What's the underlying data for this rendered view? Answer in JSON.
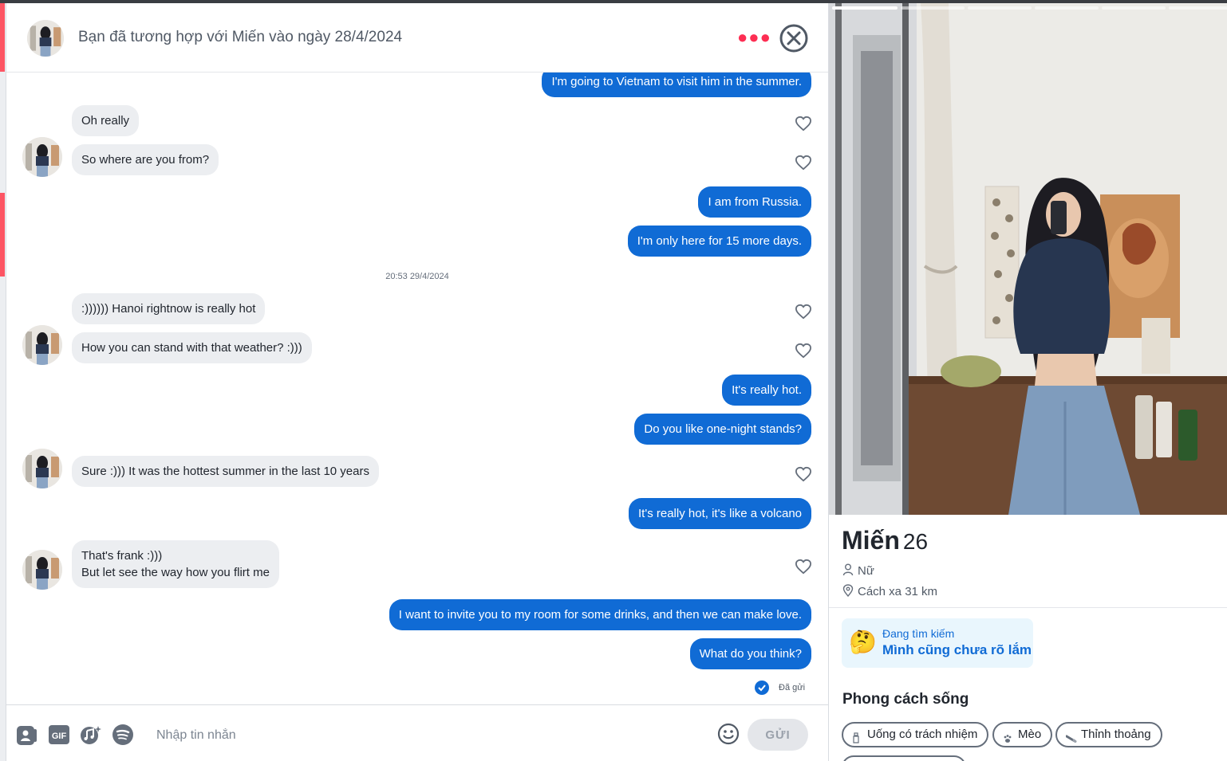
{
  "header": {
    "title": "Bạn đã tương hợp với Miến vào ngày 28/4/2024",
    "menu_icon": "more-dots-icon",
    "close_icon": "close-circle-icon"
  },
  "messages": {
    "out_0": "I'm going to Vietnam to visit him in the summer.",
    "in_1": "Oh really",
    "in_2": "So where are you from?",
    "out_3": "I am from Russia.",
    "out_4": "I'm only here for 15 more days.",
    "timestamp": "20:53 29/4/2024",
    "in_5": ":)))))) Hanoi rightnow is really hot",
    "in_6": "How you can stand with that weather? :)))",
    "out_7": "It's really hot.",
    "out_8": "Do you like one-night stands?",
    "in_9": "Sure :))) It was the hottest summer in the last 10 years",
    "out_10": "It's really hot, it's like a volcano",
    "in_11_line1": "That's frank :)))",
    "in_11_line2": "But let see the way how you flirt me",
    "out_12": "I want to invite you to my room for some drinks, and then we can make love.",
    "out_13": "What do you think?",
    "sent_status": "Đã gửi"
  },
  "composer": {
    "placeholder": "Nhập tin nhắn",
    "send_label": "GỬI",
    "gif_label": "GIF",
    "tools": [
      "sticker-card-icon",
      "gif-icon",
      "music-note-icon",
      "spotify-icon"
    ],
    "emoji_icon": "smiley-icon"
  },
  "profile": {
    "name": "Miến",
    "age": "26",
    "gender": "Nữ",
    "distance": "Cách xa 31 km",
    "looking_for_label": "Đang tìm kiếm",
    "looking_for_value": "Mình cũng chưa rõ lắm",
    "looking_for_emoji": "🤔",
    "lifestyle_title": "Phong cách sống",
    "lifestyle": [
      {
        "icon": "drink-icon",
        "label": "Uống có trách nhiệm"
      },
      {
        "icon": "paw-icon",
        "label": "Mèo"
      },
      {
        "icon": "cigarette-icon",
        "label": "Thỉnh thoảng"
      }
    ],
    "photo_count": 6,
    "active_photo": 1
  },
  "colors": {
    "accent_red": "#fd5564",
    "outgoing_bubble": "#106bd5",
    "incoming_bubble": "#eceef1"
  }
}
